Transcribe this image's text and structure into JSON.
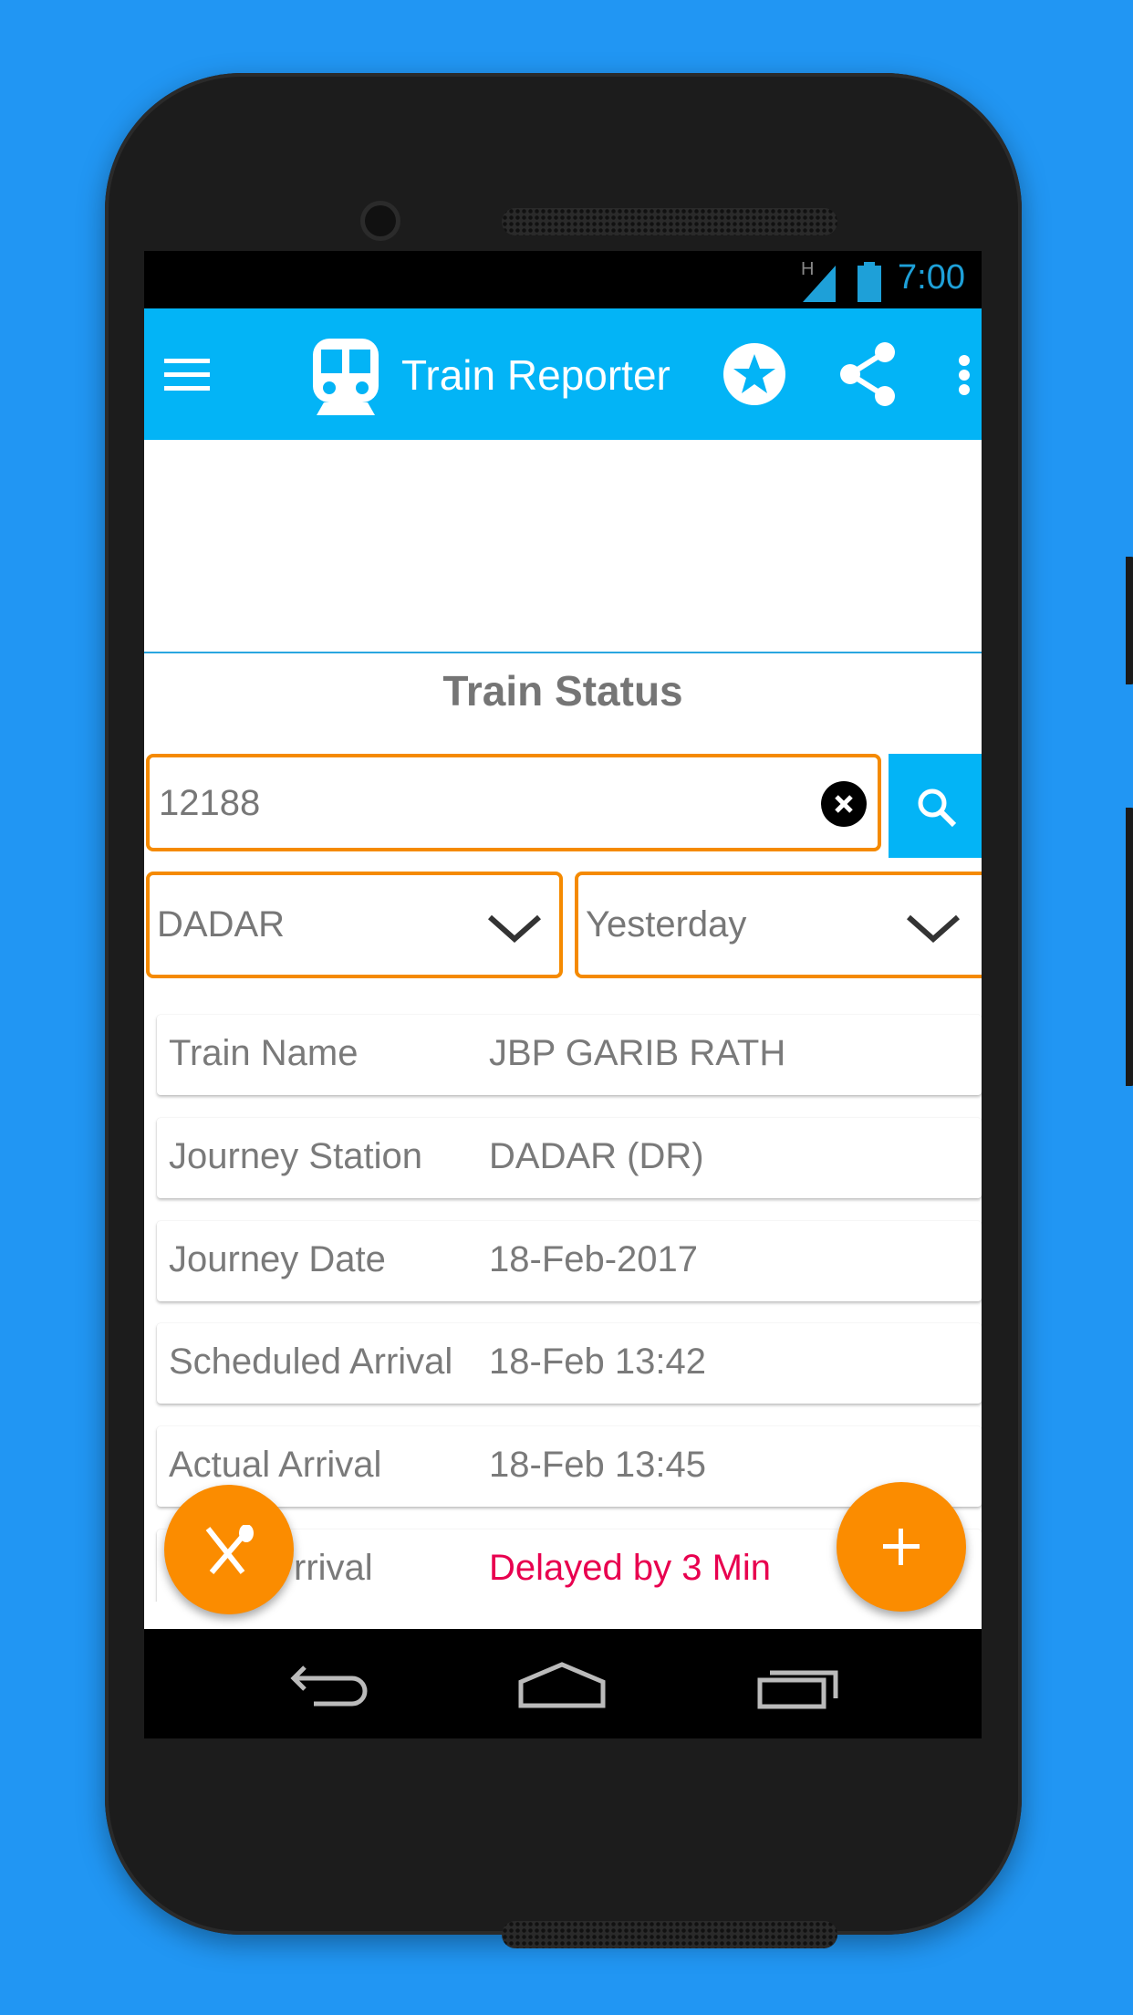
{
  "status_bar": {
    "time": "7:00",
    "network_label": "H",
    "signal_icon": "signal-icon",
    "battery_icon": "battery-icon"
  },
  "app_bar": {
    "title": "Train Reporter",
    "menu_icon": "hamburger-icon",
    "logo_icon": "train-icon",
    "actions": [
      "star-circle-icon",
      "share-icon",
      "more-vert-icon"
    ]
  },
  "section_title": "Train Status",
  "search": {
    "value": "12188",
    "clear_icon": "close-circle-icon",
    "button_icon": "search-icon"
  },
  "station_select": {
    "value": "DADAR"
  },
  "date_select": {
    "value": "Yesterday"
  },
  "details": [
    {
      "label": "Train Name",
      "value": "JBP GARIB RATH"
    },
    {
      "label": "Journey Station",
      "value": "DADAR (DR)"
    },
    {
      "label": "Journey Date",
      "value": "18-Feb-2017"
    },
    {
      "label": "Scheduled Arrival",
      "value": "18-Feb 13:42"
    },
    {
      "label": "Actual Arrival",
      "value": "18-Feb 13:45"
    },
    {
      "label": "rrival",
      "value": "Delayed by 3 Min"
    }
  ],
  "colors": {
    "accent": "#03b4f6",
    "input_border": "#f58a00",
    "fab": "#fb8c00",
    "delay_text": "#e8004f",
    "background": "#2196f3"
  },
  "fabs": {
    "left_icon": "fork-spoon-icon",
    "right_icon": "plus-icon"
  },
  "nav_bar": [
    "back-icon",
    "home-icon",
    "recents-icon"
  ]
}
